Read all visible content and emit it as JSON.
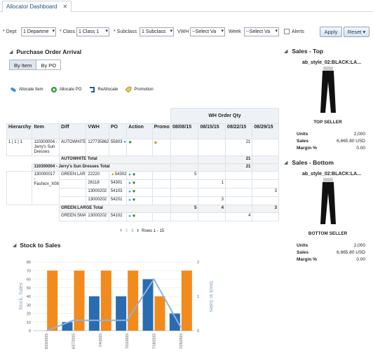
{
  "tab": {
    "title": "Allocator Dashboard",
    "close": "✕"
  },
  "filters": {
    "dept": {
      "label": "* Dept",
      "value": "1 Departme"
    },
    "class": {
      "label": "* Class",
      "value": "1 Class 1"
    },
    "subclass": {
      "label": "* Subclass",
      "value": "1 Subclass"
    },
    "vwh": {
      "label": "VWH",
      "value": "--Select Va"
    },
    "week": {
      "label": "Week",
      "value": "--Select Va"
    },
    "alerts": {
      "label": "Alerts"
    },
    "apply": "Apply",
    "reset": "Reset ▾"
  },
  "po_arrival": {
    "title": "Purchase Order Arrival",
    "toggle": [
      "By Item",
      "By PO"
    ],
    "actions": [
      "Allocate Item",
      "Allocate PO",
      "ReAllocate",
      "Promotion"
    ],
    "group_header": "WH Order Qty",
    "columns": [
      "Hierarchy",
      "Item",
      "Diff",
      "VWH",
      "PO",
      "Action",
      "Promo",
      "08/08/15",
      "08/15/15",
      "08/22/15",
      "08/29/15"
    ],
    "rows": [
      {
        "hier": "1 | 1 | 1",
        "item": "110300004 - Jerry's Sun Dresses",
        "diff": "AUTOWHITE",
        "vwh": "127735862",
        "po": "55803",
        "d1": "",
        "d2": "",
        "d3": "21",
        "d4": ""
      },
      {
        "total": "AUTOWHITE Total",
        "d1": "",
        "d2": "",
        "d3": "21",
        "d4": ""
      },
      {
        "total": "110300004 - Jerry's Sun Dresses Total",
        "d1": "",
        "d2": "",
        "d3": "21",
        "d4": ""
      },
      {
        "hier": "",
        "item": "130000017 - Fashion_X08",
        "diff": "GREEN:LARGE",
        "vwh": "22220",
        "po": "54302",
        "d1": "5",
        "d2": "",
        "d3": "",
        "d4": ""
      },
      {
        "vwh": "26118",
        "po": "54301",
        "d1": "",
        "d2": "1",
        "d3": "",
        "d4": ""
      },
      {
        "vwh": "13000202",
        "po": "54103",
        "d1": "",
        "d2": "",
        "d3": "",
        "d4": "3"
      },
      {
        "vwh": "13000202",
        "po": "54201",
        "d1": "",
        "d2": "3",
        "d3": "",
        "d4": ""
      },
      {
        "total": "GREEN:LARGE Total",
        "d1": "5",
        "d2": "4",
        "d3": "",
        "d4": "3"
      },
      {
        "diff": "GREEN:SMALL",
        "vwh": "13000202",
        "po": "54102",
        "d1": "",
        "d2": "",
        "d3": "4",
        "d4": ""
      }
    ],
    "pager": "Rows 1 - 15"
  },
  "stock_to_sales": {
    "title": "Stock to Sales",
    "chart_data": {
      "type": "bar",
      "categories": [
        "6/20/2015",
        "6/27/2015",
        "7/4/2015",
        "7/11/2015",
        "7/18/2015",
        "7/25/2015"
      ],
      "series": [
        {
          "name": "Stock",
          "values": [
            0,
            10,
            40,
            40,
            60,
            20
          ],
          "color": "#2b6cb0"
        },
        {
          "name": "Sales",
          "values": [
            70,
            70,
            70,
            70,
            40,
            70
          ],
          "color": "#f28a1c"
        }
      ],
      "line": {
        "values": [
          0,
          0.3,
          0.3,
          0.3,
          1.5,
          0.1
        ],
        "color": "#8db4e2"
      },
      "ylabel": "Stock, Sales",
      "y2label": "Stock to Sales",
      "ylim": [
        0,
        80
      ],
      "y2lim": [
        0,
        2
      ],
      "yticks": [
        "0",
        "10",
        "20",
        "30",
        "40",
        "50",
        "60",
        "70",
        "80"
      ],
      "y2ticks": [
        "0",
        "1",
        "2"
      ]
    }
  },
  "sales_top": {
    "title": "Sales - Top",
    "product": "ab_style_02:BLACK:LA...",
    "badge": "TOP SELLER",
    "units_label": "Units",
    "units": "2,000",
    "sales_label": "Sales",
    "sales": "6,665.80 USD",
    "margin_label": "Margin %",
    "margin": "0.00"
  },
  "sales_bottom": {
    "title": "Sales - Bottom",
    "product": "ab_style_02:BLACK:LA...",
    "badge": "BOTTOM SELLER",
    "units_label": "Units",
    "units": "2,000",
    "sales_label": "Sales",
    "sales": "6,665.80 USD",
    "margin_label": "Margin %",
    "margin": "0.00"
  }
}
